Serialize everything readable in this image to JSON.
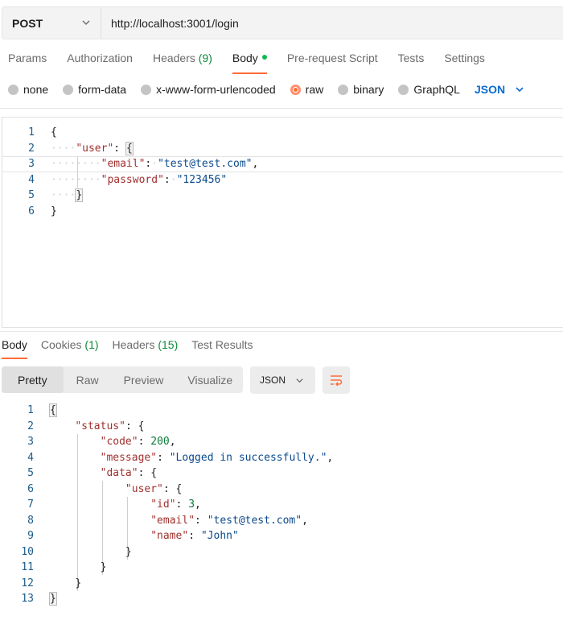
{
  "request": {
    "method": "POST",
    "url": "http://localhost:3001/login",
    "tabs": [
      {
        "label": "Params"
      },
      {
        "label": "Authorization"
      },
      {
        "label": "Headers",
        "count": "(9)"
      },
      {
        "label": "Body"
      },
      {
        "label": "Pre-request Script"
      },
      {
        "label": "Tests"
      },
      {
        "label": "Settings"
      }
    ],
    "body_types": [
      "none",
      "form-data",
      "x-www-form-urlencoded",
      "raw",
      "binary",
      "GraphQL"
    ],
    "body_type_selected": "raw",
    "body_language": "JSON",
    "line_numbers": [
      "1",
      "2",
      "3",
      "4",
      "5",
      "6"
    ],
    "body_json": {
      "open": "{",
      "user_key": "\"user\"",
      "email_key": "\"email\"",
      "email_value": "\"test@test.com\"",
      "password_key": "\"password\"",
      "password_value": "\"123456\"",
      "close": "}"
    }
  },
  "response": {
    "tabs": [
      {
        "label": "Body"
      },
      {
        "label": "Cookies",
        "count": "(1)"
      },
      {
        "label": "Headers",
        "count": "(15)"
      },
      {
        "label": "Test Results"
      }
    ],
    "view_modes": [
      "Pretty",
      "Raw",
      "Preview",
      "Visualize"
    ],
    "format": "JSON",
    "line_numbers": [
      "1",
      "2",
      "3",
      "4",
      "5",
      "6",
      "7",
      "8",
      "9",
      "10",
      "11",
      "12",
      "13"
    ],
    "body_json": {
      "status_key": "\"status\"",
      "code_key": "\"code\"",
      "code_value": "200",
      "message_key": "\"message\"",
      "message_value": "\"Logged in successfully.\"",
      "data_key": "\"data\"",
      "user_key": "\"user\"",
      "id_key": "\"id\"",
      "id_value": "3",
      "email_key": "\"email\"",
      "email_value": "\"test@test.com\"",
      "name_key": "\"name\"",
      "name_value": "\"John\""
    }
  },
  "colors": {
    "accent": "#ff6c37",
    "count_green": "#0c8a3c",
    "json_link": "#0b6bcf"
  }
}
